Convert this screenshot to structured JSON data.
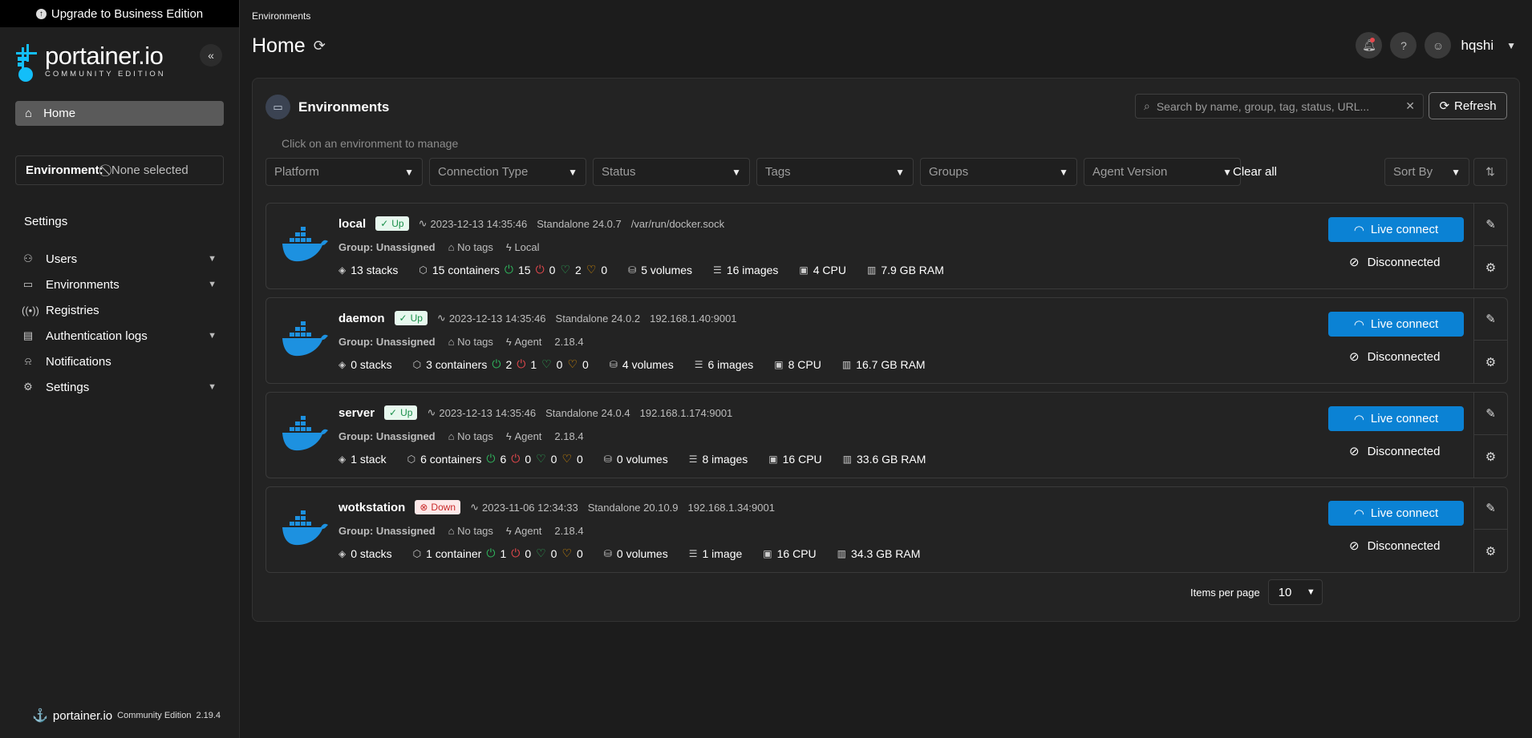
{
  "upgrade_banner": "Upgrade to Business Edition",
  "brand": {
    "title": "portainer.io",
    "subtitle": "COMMUNITY EDITION"
  },
  "sidebar": {
    "home_label": "Home",
    "environment_label": "Environment:",
    "environment_value": "None selected",
    "settings_heading": "Settings",
    "items": [
      {
        "label": "Users",
        "icon": "users-icon",
        "expandable": true
      },
      {
        "label": "Environments",
        "icon": "environments-icon",
        "expandable": true
      },
      {
        "label": "Registries",
        "icon": "registries-icon",
        "expandable": false
      },
      {
        "label": "Authentication logs",
        "icon": "auth-logs-icon",
        "expandable": true
      },
      {
        "label": "Notifications",
        "icon": "bell-icon",
        "expandable": false
      },
      {
        "label": "Settings",
        "icon": "gear-icon",
        "expandable": true
      }
    ],
    "footer": {
      "brand": "portainer.io",
      "edition": "Community Edition",
      "version": "2.19.4"
    }
  },
  "header": {
    "breadcrumb": "Environments",
    "title": "Home",
    "username": "hqshi"
  },
  "panel": {
    "title": "Environments",
    "search_placeholder": "Search by name, group, tag, status, URL...",
    "refresh_label": "Refresh",
    "hint": "Click on an environment to manage",
    "filters": [
      "Platform",
      "Connection Type",
      "Status",
      "Tags",
      "Groups",
      "Agent Version"
    ],
    "clear_all": "Clear all",
    "sort_by": "Sort By",
    "items_per_page_label": "Items per page",
    "items_per_page_value": "10"
  },
  "environments": [
    {
      "name": "local",
      "status": "Up",
      "time": "2023-12-13 14:35:46",
      "standalone": "Standalone 24.0.7",
      "url": "/var/run/docker.sock",
      "group": "Group: Unassigned",
      "tags": "No tags",
      "connection": "Local",
      "agent_version": "",
      "stacks": "13 stacks",
      "containers": "15 containers",
      "running": "15",
      "stopped": "0",
      "healthy": "2",
      "unhealthy": "0",
      "volumes": "5 volumes",
      "images": "16 images",
      "cpu": "4 CPU",
      "ram": "7.9 GB RAM",
      "live": "Live connect",
      "disconnected": "Disconnected"
    },
    {
      "name": "daemon",
      "status": "Up",
      "time": "2023-12-13 14:35:46",
      "standalone": "Standalone 24.0.2",
      "url": "192.168.1.40:9001",
      "group": "Group: Unassigned",
      "tags": "No tags",
      "connection": "Agent",
      "agent_version": "2.18.4",
      "stacks": "0 stacks",
      "containers": "3 containers",
      "running": "2",
      "stopped": "1",
      "healthy": "0",
      "unhealthy": "0",
      "volumes": "4 volumes",
      "images": "6 images",
      "cpu": "8 CPU",
      "ram": "16.7 GB RAM",
      "live": "Live connect",
      "disconnected": "Disconnected"
    },
    {
      "name": "server",
      "status": "Up",
      "time": "2023-12-13 14:35:46",
      "standalone": "Standalone 24.0.4",
      "url": "192.168.1.174:9001",
      "group": "Group: Unassigned",
      "tags": "No tags",
      "connection": "Agent",
      "agent_version": "2.18.4",
      "stacks": "1 stack",
      "containers": "6 containers",
      "running": "6",
      "stopped": "0",
      "healthy": "0",
      "unhealthy": "0",
      "volumes": "0 volumes",
      "images": "8 images",
      "cpu": "16 CPU",
      "ram": "33.6 GB RAM",
      "live": "Live connect",
      "disconnected": "Disconnected"
    },
    {
      "name": "wotkstation",
      "status": "Down",
      "time": "2023-11-06 12:34:33",
      "standalone": "Standalone 20.10.9",
      "url": "192.168.1.34:9001",
      "group": "Group: Unassigned",
      "tags": "No tags",
      "connection": "Agent",
      "agent_version": "2.18.4",
      "stacks": "0 stacks",
      "containers": "1 container",
      "running": "1",
      "stopped": "0",
      "healthy": "0",
      "unhealthy": "0",
      "volumes": "0 volumes",
      "images": "1 image",
      "cpu": "16 CPU",
      "ram": "34.3 GB RAM",
      "live": "Live connect",
      "disconnected": "Disconnected"
    }
  ]
}
